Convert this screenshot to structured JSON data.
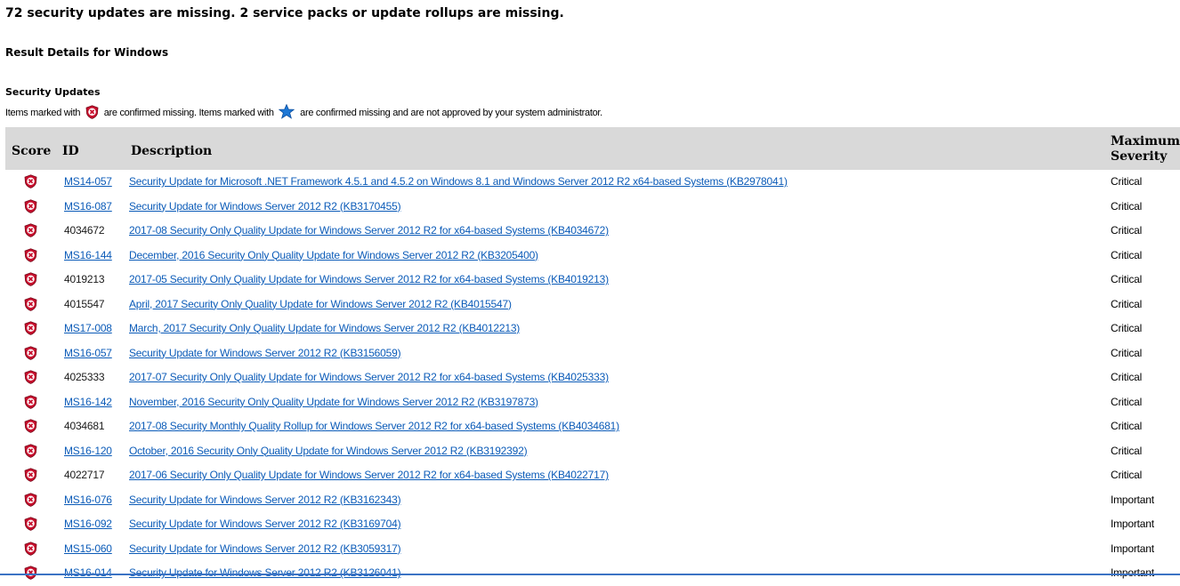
{
  "summary": "72 security updates are missing. 2 service packs or update rollups are missing.",
  "result_title": "Result Details for Windows",
  "section_title": "Security Updates",
  "legend": {
    "part1": "Items marked with",
    "part2": "are confirmed missing. Items marked with",
    "part3": "are confirmed missing and are not approved by your system administrator."
  },
  "table": {
    "headers": {
      "score": "Score",
      "id": "ID",
      "description": "Description",
      "severity_line1": "Maximum",
      "severity_line2": "Severity"
    },
    "rows": [
      {
        "id": "MS14-057",
        "id_link": true,
        "description": "Security Update for Microsoft .NET Framework 4.5.1 and 4.5.2 on Windows 8.1 and Windows Server 2012 R2 x64-based Systems (KB2978041)",
        "severity": "Critical"
      },
      {
        "id": "MS16-087",
        "id_link": true,
        "description": "Security Update for Windows Server 2012 R2 (KB3170455)",
        "severity": "Critical"
      },
      {
        "id": "4034672",
        "id_link": false,
        "description": "2017-08 Security Only Quality Update for Windows Server 2012 R2 for x64-based Systems (KB4034672)",
        "severity": "Critical"
      },
      {
        "id": "MS16-144",
        "id_link": true,
        "description": "December, 2016 Security Only Quality Update for Windows Server 2012 R2 (KB3205400)",
        "severity": "Critical"
      },
      {
        "id": "4019213",
        "id_link": false,
        "description": "2017-05 Security Only Quality Update for Windows Server 2012 R2 for x64-based Systems (KB4019213)",
        "severity": "Critical"
      },
      {
        "id": "4015547",
        "id_link": false,
        "description": "April, 2017 Security Only Quality Update for Windows Server 2012 R2 (KB4015547)",
        "severity": "Critical"
      },
      {
        "id": "MS17-008",
        "id_link": true,
        "description": "March, 2017 Security Only Quality Update for Windows Server 2012 R2 (KB4012213)",
        "severity": "Critical"
      },
      {
        "id": "MS16-057",
        "id_link": true,
        "description": "Security Update for Windows Server 2012 R2 (KB3156059)",
        "severity": "Critical"
      },
      {
        "id": "4025333",
        "id_link": false,
        "description": "2017-07 Security Only Quality Update for Windows Server 2012 R2 for x64-based Systems (KB4025333)",
        "severity": "Critical"
      },
      {
        "id": "MS16-142",
        "id_link": true,
        "description": "November, 2016 Security Only Quality Update for Windows Server 2012 R2 (KB3197873)",
        "severity": "Critical"
      },
      {
        "id": "4034681",
        "id_link": false,
        "description": "2017-08 Security Monthly Quality Rollup for Windows Server 2012 R2 for x64-based Systems (KB4034681)",
        "severity": "Critical"
      },
      {
        "id": "MS16-120",
        "id_link": true,
        "description": "October, 2016 Security Only Quality Update for Windows Server 2012 R2 (KB3192392)",
        "severity": "Critical"
      },
      {
        "id": "4022717",
        "id_link": false,
        "description": "2017-06 Security Only Quality Update for Windows Server 2012 R2 for x64-based Systems (KB4022717)",
        "severity": "Critical"
      },
      {
        "id": "MS16-076",
        "id_link": true,
        "description": "Security Update for Windows Server 2012 R2 (KB3162343)",
        "severity": "Important"
      },
      {
        "id": "MS16-092",
        "id_link": true,
        "description": "Security Update for Windows Server 2012 R2 (KB3169704)",
        "severity": "Important"
      },
      {
        "id": "MS15-060",
        "id_link": true,
        "description": "Security Update for Windows Server 2012 R2 (KB3059317)",
        "severity": "Important"
      },
      {
        "id": "MS16-014",
        "id_link": true,
        "description": "Security Update for Windows Server 2012 R2 (KB3126041)",
        "severity": "Important"
      }
    ]
  },
  "icons": {
    "missing": "missing-update-shield-icon",
    "not_approved": "not-approved-star-icon"
  },
  "colors": {
    "link": "#0b5bb8",
    "header_bg": "#d9d9d9",
    "missing_icon": "#c8102e",
    "star_icon": "#1e78d6"
  }
}
